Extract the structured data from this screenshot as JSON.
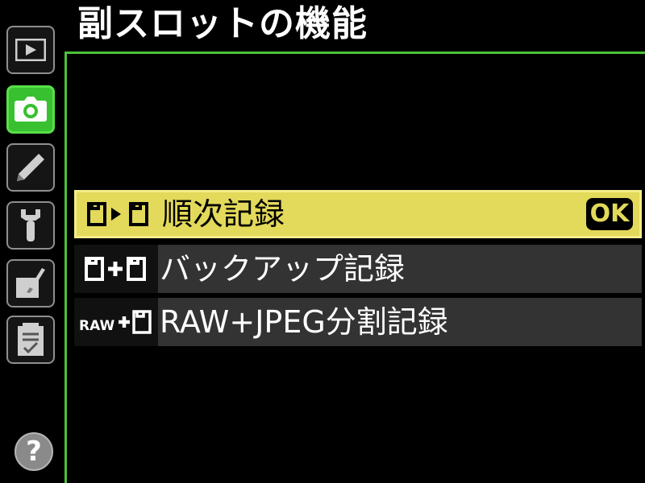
{
  "title": "副スロットの機能",
  "sidebar": {
    "tabs": [
      {
        "name": "playback",
        "icon": "play-icon",
        "active": false
      },
      {
        "name": "shooting",
        "icon": "camera-icon",
        "active": true
      },
      {
        "name": "custom-settings",
        "icon": "pencil-icon",
        "active": false
      },
      {
        "name": "setup",
        "icon": "wrench-icon",
        "active": false
      },
      {
        "name": "retouch",
        "icon": "brush-icon",
        "active": false
      },
      {
        "name": "my-menu",
        "icon": "list-icon",
        "active": false
      }
    ],
    "help_label": "?"
  },
  "options": [
    {
      "label": "順次記録",
      "icon": "overflow-icon",
      "icon_text": "",
      "selected": true
    },
    {
      "label": "バックアップ記録",
      "icon": "backup-icon",
      "icon_text": "",
      "selected": false
    },
    {
      "label": "RAW+JPEG分割記録",
      "icon": "raw-jpeg-icon",
      "icon_text": "RAW",
      "selected": false
    }
  ],
  "ok_label": "OK",
  "colors": {
    "background": "#000000",
    "accent_green": "#38c030",
    "highlight_yellow": "#e3d95a",
    "row_gray": "#333333"
  }
}
